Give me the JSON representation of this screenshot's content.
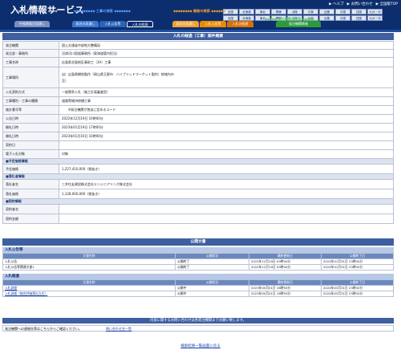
{
  "header": {
    "title": "入札情報サービス",
    "top_links": [
      "ヘルプ",
      "お問い合わせ",
      "全国版TOP"
    ],
    "regions_row1": [
      "全国",
      "北海道",
      "東北",
      "関東",
      "北陸",
      "中部",
      "近畿",
      "中国",
      "四国",
      "九州・沖縄"
    ],
    "regions_row2": [
      "全国",
      "北海道",
      "東北",
      "関東",
      "北陸",
      "中部",
      "近畿",
      "中国",
      "四国",
      "九州・沖縄"
    ],
    "categories": [
      {
        "label": "中長期の発注",
        "color": "#7a8fbf"
      },
      {
        "label": "工事の検索",
        "color": "#1f6fd0"
      },
      {
        "label": "業務の検索",
        "color": "#f08a00"
      },
      {
        "label": "発注機関の検索",
        "color": "#2c9a3a"
      }
    ],
    "tabs": [
      {
        "label": "中長期発注見通し",
        "color": "#7a8fbf"
      },
      {
        "label": "発注の見通し",
        "color": "#3a78cf"
      },
      {
        "label": "入札公告等",
        "color": "#2b62b8"
      },
      {
        "label": "入札の経過",
        "color": "#0d2e6e"
      },
      {
        "label": "発注の見通し",
        "color": "#f0a030"
      },
      {
        "label": "入札公告等",
        "color": "#ec8a00"
      },
      {
        "label": "入札の経過",
        "color": "#d97000"
      },
      {
        "label": "発注機関情報",
        "color": "#2c9a3a"
      }
    ]
  },
  "main": {
    "section_title": "入札の経過（工事）案件概要",
    "rows": [
      {
        "label": "発注機関",
        "value": "国土交通省中部地方整備局"
      },
      {
        "label": "発注部・事務所",
        "value": "沼津河川国道事務所（東海道管内担当）"
      },
      {
        "label": "工事名称",
        "value": "広島県北島地区事前工（3A）工事"
      },
      {
        "label": "工事場所",
        "value": "自）広島県網地製作（岡山県玉野市　ハイブリッドマーケット製作）地域内市\n至）"
      },
      {
        "label": "入札契約方式",
        "value": "一般競争入札（施工計画審査型）"
      },
      {
        "label": "工事種別・工事の種類",
        "value": "道路等維持修繕工事"
      },
      {
        "label": "施計番号等",
        "value": "　　※発注機関が独自に定めるコード"
      },
      {
        "label": "公告日時",
        "value": "2022年12月19日 10時00分"
      },
      {
        "label": "開札日時",
        "value": "2023年01月19日 17時00分"
      },
      {
        "label": "開札日時",
        "value": "2023年01月16日 10時00分"
      },
      {
        "label": "契約日",
        "value": ""
      },
      {
        "label": "電子入札対象",
        "value": "対象"
      }
    ],
    "group_price": "■予定価格情報",
    "price_rows": [
      {
        "label": "予定価格",
        "value": "1,227,410,000（税抜き）"
      }
    ],
    "group_winner": "■落札者情報",
    "winner_rows": [
      {
        "label": "落札者名",
        "value": "三井住友建設株式会社エンジニアリング株式会社"
      },
      {
        "label": "落札価格",
        "value": "1,128,000,000（税抜き）"
      }
    ],
    "group_contract": "■契約情報",
    "contract_rows": [
      {
        "label": "契約者名",
        "value": ""
      },
      {
        "label": "契約金額",
        "value": ""
      }
    ]
  },
  "documents": {
    "title": "公開文書",
    "notice": {
      "label": "入札公告等",
      "columns": [
        "文書名称",
        "公開状況",
        "最終更新日",
        "公開終了日"
      ],
      "rows": [
        [
          "入札公告",
          "公開終了",
          "2022年12月19日 09時40分",
          "2024年01月31日 23時00分"
        ],
        [
          "入札公告等関連文書1",
          "公開終了",
          "2022年12月19日 09時40分",
          "2024年01月31日 23時00分"
        ]
      ]
    },
    "progress": {
      "label": "入札経過",
      "columns": [
        "文書名称",
        "公開状況",
        "最終更新日",
        "公開終了日"
      ],
      "rows": [
        [
          "入札調書",
          "公開中",
          "2023年05月01日 16時50分",
          "2024年03月31日 23時00分"
        ],
        [
          "入札調書（総合評価落札方式）",
          "公開中",
          "2023年05月01日 16時50分",
          "2024年03月31日 23時00分"
        ]
      ]
    }
  },
  "contact": {
    "title": "内容に関するお問い合わせは各発注機関までお願い致します。",
    "text": "発注機関への連絡先等はこちらからご確認ください。",
    "link": "問い合わせ先一覧"
  },
  "footer": {
    "back_link": "検索結果一覧画面に戻る"
  }
}
